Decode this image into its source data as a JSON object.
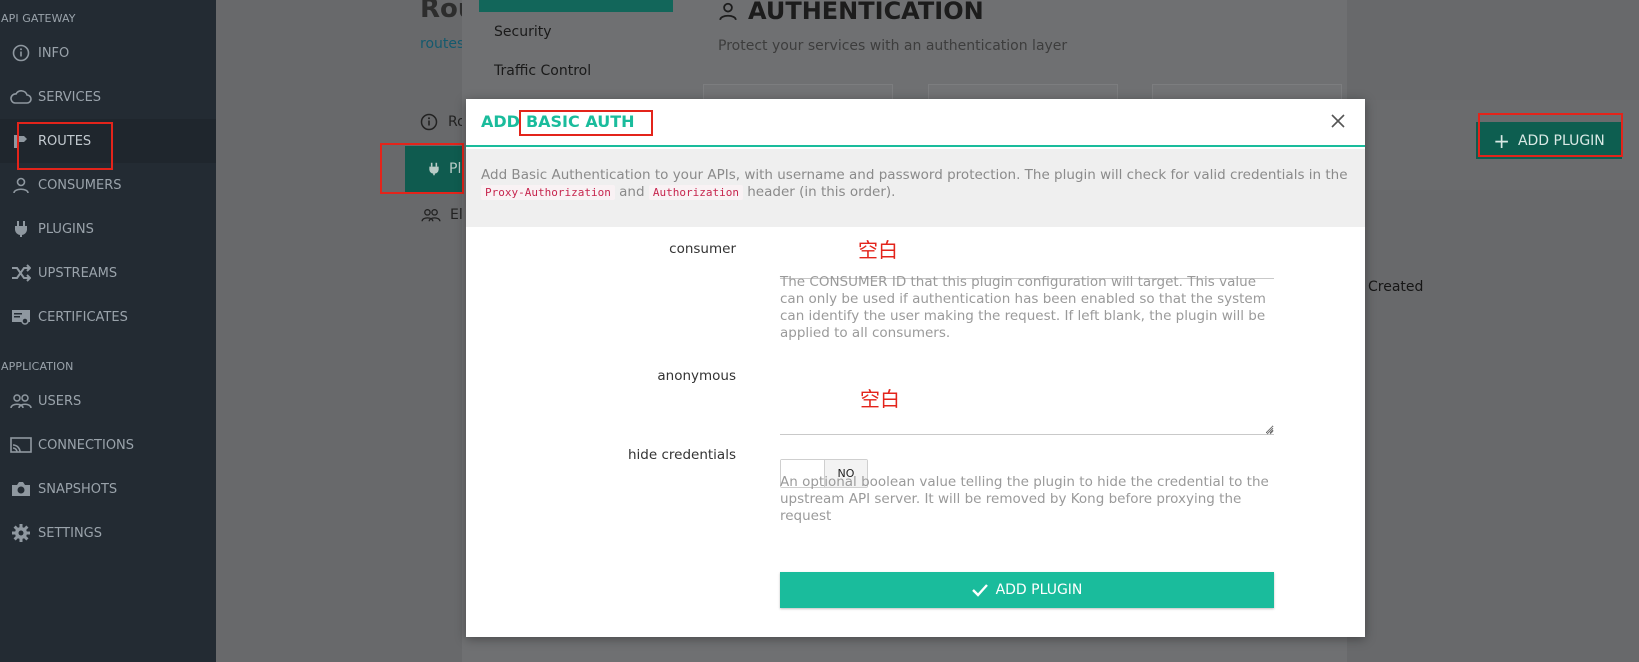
{
  "sidebar": {
    "section_gateway": "API GATEWAY",
    "section_application": "APPLICATION",
    "gateway_items": [
      {
        "label": "INFO",
        "icon": "info-icon"
      },
      {
        "label": "SERVICES",
        "icon": "cloud-icon"
      },
      {
        "label": "ROUTES",
        "icon": "routes-icon"
      },
      {
        "label": "CONSUMERS",
        "icon": "user-icon"
      },
      {
        "label": "PLUGINS",
        "icon": "plug-icon"
      },
      {
        "label": "UPSTREAMS",
        "icon": "shuffle-icon"
      },
      {
        "label": "CERTIFICATES",
        "icon": "certificate-icon"
      }
    ],
    "application_items": [
      {
        "label": "USERS",
        "icon": "users-icon"
      },
      {
        "label": "CONNECTIONS",
        "icon": "cast-icon"
      },
      {
        "label": "SNAPSHOTS",
        "icon": "camera-icon"
      },
      {
        "label": "SETTINGS",
        "icon": "gear-icon"
      }
    ],
    "active_item": "ROUTES"
  },
  "background": {
    "page_title": "Rou",
    "breadcrumb": "routes",
    "plugin_sections": [
      "Security",
      "Traffic Control"
    ],
    "section_title": "AUTHENTICATION",
    "section_subtitle": "Protect your services with an authentication layer",
    "add_plugin_label": "ADD PLUGIN",
    "info_row_label": "Ro",
    "plugins_tab_label": "Pl",
    "eligible_row_label": "El",
    "created_label": "Created"
  },
  "modal": {
    "title_prefix": "ADD",
    "title_name": "BASIC AUTH",
    "description_part1": "Add Basic Authentication to your APIs, with username and password protection. The plugin will check for valid credentials in the",
    "code1": "Proxy-Authorization",
    "description_and": "and",
    "code2": "Authorization",
    "description_part2": "header (in this order).",
    "fields": {
      "consumer": {
        "label": "consumer",
        "value": "",
        "help": "The CONSUMER ID that this plugin configuration will target. This value can only be used if authentication has been enabled so that the system can identify the user making the request. If left blank, the plugin will be applied to all consumers."
      },
      "anonymous": {
        "label": "anonymous",
        "value": ""
      },
      "hide_credentials": {
        "label": "hide credentials",
        "state": "NO",
        "help": "An optional boolean value telling the plugin to hide the credential to the upstream API server. It will be removed by Kong before proxying the request"
      }
    },
    "submit_label": "ADD PLUGIN"
  },
  "annotations": {
    "blank_mark_1": "空白",
    "blank_mark_2": "空白"
  },
  "colors": {
    "accent": "#1abc9c",
    "sidebar_bg": "#232b33",
    "annotation_red": "#e3241b"
  }
}
